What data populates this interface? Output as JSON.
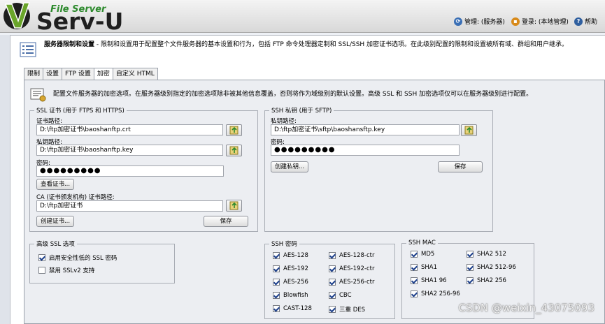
{
  "app": {
    "logo_sub": "File Server",
    "logo_main": "Serv-U"
  },
  "header_links": {
    "manage": "管理: (服务器)",
    "login": "登录: (本地管理)",
    "help": "帮助"
  },
  "page": {
    "title": "服务器限制和设置",
    "description": " - 限制和设置用于配置整个文件服务器的基本设置和行为，包括 FTP 命令处理器定制和 SSL/SSH 加密证书选项。在此级别配置的限制和设置被所有域、群组和用户继承。"
  },
  "tabs": [
    "限制",
    "设置",
    "FTP 设置",
    "加密",
    "自定义 HTML"
  ],
  "active_tab": "加密",
  "encryption": {
    "intro": "配置文件服务器的加密选项。在服务器级别指定的加密选项除非被其他信息覆盖，否则将作为域级别的默认设置。高级 SSL 和 SSH 加密选项仅可以在服务器级别进行配置。",
    "ssl": {
      "legend": "SSL 证书 (用于 FTPS 和 HTTPS)",
      "cert_label": "证书路径:",
      "cert_value": "D:\\ftp加密证书\\baoshanftp.crt",
      "key_label": "私钥路径:",
      "key_value": "D:\\ftp加密证书\\baoshanftp.key",
      "pw_label": "密码:",
      "pw_value": "●●●●●●●●●",
      "view_btn": "查看证书...",
      "ca_label": "CA (证书颁发机构) 证书路径:",
      "ca_value": "D:\\ftp加密证书",
      "create_btn": "创建证书...",
      "save_btn": "保存"
    },
    "ssh": {
      "legend": "SSH 私钥 (用于 SFTP)",
      "key_label": "私钥路径:",
      "key_value": "D:\\ftp加密证书\\sftp\\baoshansftp.key",
      "pw_label": "密码:",
      "pw_value": "●●●●●●●●●",
      "create_btn": "创建私钥...",
      "save_btn": "保存"
    },
    "adv_ssl": {
      "legend": "高级 SSL 选项",
      "opt1": "启用安全性低的 SSL 密码",
      "opt1_checked": true,
      "opt2": "禁用 SSLv2 支持",
      "opt2_checked": false
    },
    "ssh_ciphers": {
      "legend": "SSH 密码",
      "items": [
        {
          "label": "AES-128",
          "checked": true
        },
        {
          "label": "AES-128-ctr",
          "checked": true
        },
        {
          "label": "AES-192",
          "checked": true
        },
        {
          "label": "AES-192-ctr",
          "checked": true
        },
        {
          "label": "AES-256",
          "checked": true
        },
        {
          "label": "AES-256-ctr",
          "checked": true
        },
        {
          "label": "Blowfish",
          "checked": true
        },
        {
          "label": "CBC",
          "checked": true
        },
        {
          "label": "CAST-128",
          "checked": true
        },
        {
          "label": "三重 DES",
          "checked": true
        }
      ]
    },
    "ssh_mac": {
      "legend": "SSH MAC",
      "items": [
        {
          "label": "MD5",
          "checked": true
        },
        {
          "label": "SHA2 512",
          "checked": true
        },
        {
          "label": "SHA1",
          "checked": true
        },
        {
          "label": "SHA2 512-96",
          "checked": true
        },
        {
          "label": "SHA1 96",
          "checked": true
        },
        {
          "label": "SHA2 256",
          "checked": true
        },
        {
          "label": "SHA2 256-96",
          "checked": true
        }
      ]
    }
  },
  "watermark": "CSDN @weixin_43075093",
  "colors": {
    "logo_green": "#2d8a2d",
    "check_blue": "#1c3f8a"
  }
}
